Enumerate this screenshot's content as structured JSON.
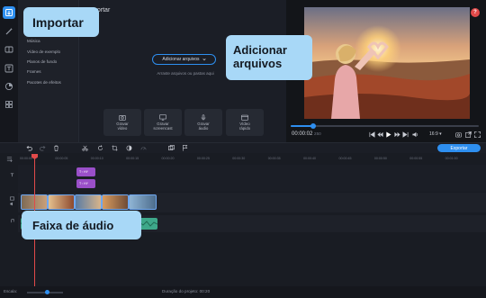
{
  "sidebar_icons": [
    {
      "name": "import-icon",
      "active": true
    },
    {
      "name": "magic-wand-icon",
      "active": false
    },
    {
      "name": "transitions-icon",
      "active": false
    },
    {
      "name": "titles-icon",
      "active": false
    },
    {
      "name": "stickers-icon",
      "active": false
    },
    {
      "name": "more-tools-icon",
      "active": false
    }
  ],
  "import_panel": {
    "title": "portar",
    "categories": [
      "Música",
      "Vídeo de exemplo",
      "Planos de fundo",
      "Frames",
      "Pacotes de efeitos"
    ],
    "add_files_button": "Adicionar arquivos",
    "drag_text": "Arraste arquivos ou pastas aqui",
    "tiles": [
      {
        "label": "Gravar\nvídeo",
        "icon": "camera-icon"
      },
      {
        "label": "Gravar\nscreencast",
        "icon": "monitor-icon"
      },
      {
        "label": "Gravar\náudio",
        "icon": "microphone-icon"
      },
      {
        "label": "Vídeo\nrápido",
        "icon": "film-icon"
      }
    ]
  },
  "player": {
    "help_label": "?",
    "time_current": "00:00:02",
    "time_fraction": "250",
    "aspect_ratio": "16:9",
    "progress": 0.12
  },
  "timeline": {
    "ruler_ticks": [
      "00:00:00",
      "00:00:05",
      "00:00:10",
      "00:00:15",
      "00:00:20",
      "00:00:25",
      "00:00:30",
      "00:00:35",
      "00:00:40",
      "00:00:45",
      "00:00:50",
      "00:00:55",
      "00:01:00"
    ],
    "title_clips": [
      {
        "label": "T↑ HY"
      },
      {
        "label": "T↑ HY"
      }
    ]
  },
  "toolbar": {
    "export_label": "Exportar"
  },
  "status": {
    "scale_label": "Escala:",
    "duration_text": "Duração do projeto: 00:20"
  },
  "callouts": {
    "importar": "Importar",
    "adicionar": "Adicionar\narquivos",
    "faixa_audio": "Faixa de áudio"
  },
  "colors": {
    "accent": "#2e8ff0",
    "callout": "#a8d8f7",
    "playhead": "#e14a4a",
    "title_clip": "#9a4fc9",
    "audio_clip": "#3ea88a"
  }
}
